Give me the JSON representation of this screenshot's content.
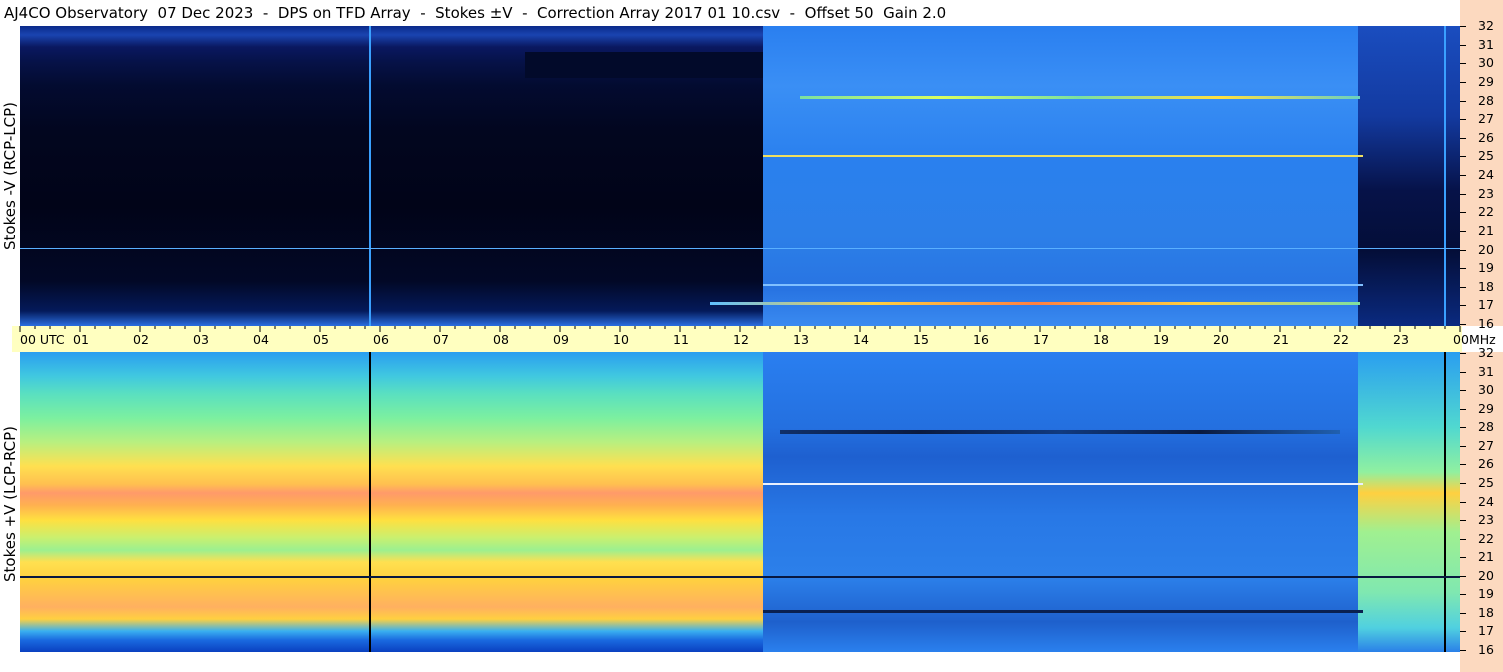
{
  "title": "AJ4CO Observatory  07 Dec 2023  -  DPS on TFD Array  -  Stokes ±V  -  Correction Array 2017 01 10.csv  -  Offset 50  Gain 2.0",
  "panels": {
    "top": {
      "ylabel": "Stokes -V (RCP-LCP)"
    },
    "bottom": {
      "ylabel": "Stokes +V (LCP-RCP)"
    }
  },
  "time_axis": {
    "labels": [
      "00  UTC",
      "01",
      "02",
      "03",
      "04",
      "05",
      "06",
      "07",
      "08",
      "09",
      "10",
      "11",
      "12",
      "13",
      "14",
      "15",
      "16",
      "17",
      "18",
      "19",
      "20",
      "21",
      "22",
      "23",
      "00"
    ]
  },
  "freq_axis": {
    "unit": "MHz",
    "labels": [
      "32",
      "31",
      "30",
      "29",
      "28",
      "27",
      "26",
      "25",
      "24",
      "23",
      "22",
      "21",
      "20",
      "19",
      "18",
      "17",
      "16"
    ]
  },
  "colors": {
    "top_night": "#01021f",
    "top_day": "#1e6fe0",
    "bottom_night_hot": "#ff9060",
    "bottom_day": "#1a5fd6",
    "time_bar": "#ffffc0",
    "freq_strip": "#fcd9bf"
  }
}
